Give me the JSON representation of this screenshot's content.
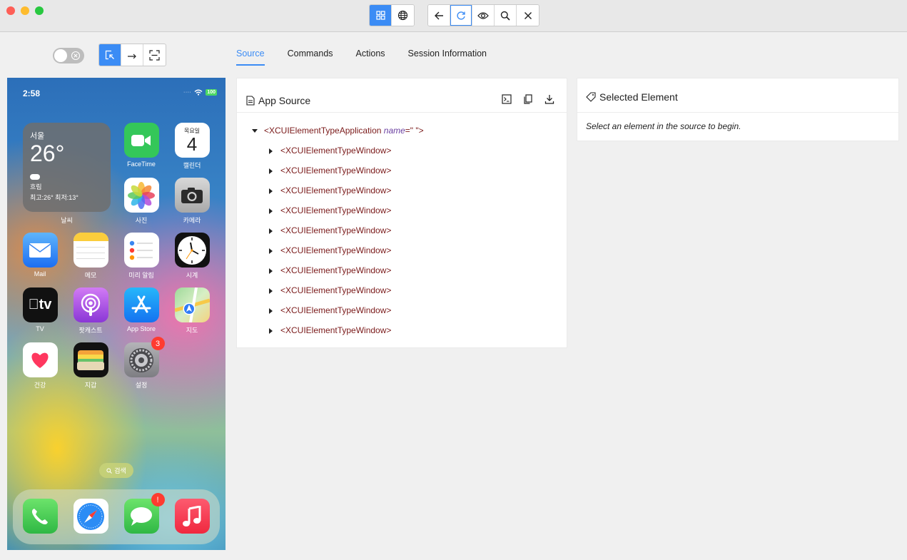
{
  "toolbar": {
    "view_buttons": [
      {
        "icon": "grid-icon",
        "active": true
      },
      {
        "icon": "globe-icon",
        "active": false
      }
    ],
    "nav_buttons": [
      {
        "icon": "back-arrow-icon"
      },
      {
        "icon": "refresh-icon"
      },
      {
        "icon": "eye-icon"
      },
      {
        "icon": "search-icon"
      },
      {
        "icon": "close-icon"
      }
    ]
  },
  "mode_buttons": [
    {
      "icon": "select-element-icon",
      "active": true
    },
    {
      "icon": "swipe-arrow-icon",
      "active": false
    },
    {
      "icon": "screenshot-frame-icon",
      "active": false
    }
  ],
  "tabs": [
    {
      "label": "Source",
      "active": true
    },
    {
      "label": "Commands",
      "active": false
    },
    {
      "label": "Actions",
      "active": false
    },
    {
      "label": "Session Information",
      "active": false
    }
  ],
  "phone": {
    "time": "2:58",
    "battery": "100",
    "weather": {
      "city": "서울",
      "temp": "26°",
      "condition": "흐림",
      "high_low": "최고:26° 최저:13°",
      "label": "날씨"
    },
    "calendar": {
      "day": "목요일",
      "date": "4"
    },
    "apps": [
      {
        "id": "facetime",
        "label": "FaceTime",
        "color": "#34c759"
      },
      {
        "id": "calendar",
        "label": "캘린더",
        "color": "#ffffff"
      },
      {
        "id": "photos",
        "label": "사진",
        "color": "#ffffff"
      },
      {
        "id": "camera",
        "label": "카메라",
        "color": "#bdbdbd"
      },
      {
        "id": "mail",
        "label": "Mail",
        "color": "#2f8cf5"
      },
      {
        "id": "notes",
        "label": "메모",
        "color": "#ffffff"
      },
      {
        "id": "reminders",
        "label": "미리 알림",
        "color": "#ffffff"
      },
      {
        "id": "clock",
        "label": "시계",
        "color": "#111111"
      },
      {
        "id": "tv",
        "label": "TV",
        "color": "#111111"
      },
      {
        "id": "podcasts",
        "label": "팟캐스트",
        "color": "#9b4fd9"
      },
      {
        "id": "appstore",
        "label": "App Store",
        "color": "#1b8df5"
      },
      {
        "id": "maps",
        "label": "지도",
        "color": "#8fd38b"
      },
      {
        "id": "health",
        "label": "건강",
        "color": "#ffffff"
      },
      {
        "id": "wallet",
        "label": "지갑",
        "color": "#111111"
      },
      {
        "id": "settings",
        "label": "설정",
        "color": "#8e8e93",
        "badge": "3"
      }
    ],
    "search_label": "검색",
    "dock": [
      {
        "id": "phone",
        "color": "#34c759"
      },
      {
        "id": "safari",
        "color": "#ffffff"
      },
      {
        "id": "messages",
        "color": "#34c759",
        "badge": "!"
      },
      {
        "id": "music",
        "color": "#fc3c44"
      }
    ]
  },
  "source_panel": {
    "title": "App Source",
    "tools": [
      "terminal-icon",
      "copy-icon",
      "download-icon"
    ],
    "root": {
      "tag": "<XCUIElementTypeApplication",
      "attr": "name",
      "attr_eq": "=\" \">"
    },
    "children": [
      "<XCUIElementTypeWindow>",
      "<XCUIElementTypeWindow>",
      "<XCUIElementTypeWindow>",
      "<XCUIElementTypeWindow>",
      "<XCUIElementTypeWindow>",
      "<XCUIElementTypeWindow>",
      "<XCUIElementTypeWindow>",
      "<XCUIElementTypeWindow>",
      "<XCUIElementTypeWindow>",
      "<XCUIElementTypeWindow>"
    ]
  },
  "selected_panel": {
    "title": "Selected Element",
    "message": "Select an element in the source to begin."
  }
}
